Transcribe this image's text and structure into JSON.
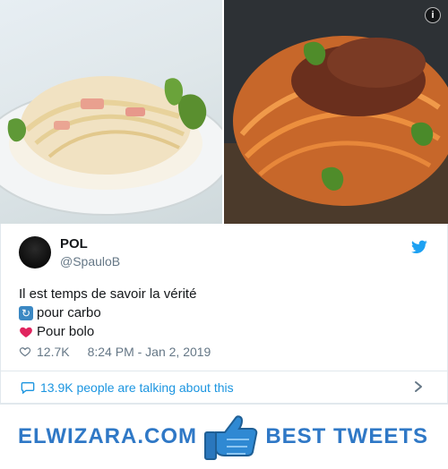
{
  "media": {
    "left_alt": "carbonara",
    "right_alt": "bolognese"
  },
  "tweet": {
    "name": "POL",
    "handle": "@SpauloB",
    "lines": [
      "Il est temps de savoir la vérité",
      "pour carbo",
      "Pour bolo"
    ],
    "likes": "12.7K",
    "timestamp": "8:24 PM - Jan 2, 2019",
    "conversation": "13.9K people are talking about this"
  },
  "footer": {
    "left_brand": "ELWIZARA.COM",
    "right_brand": "BEST TWEETS"
  },
  "colors": {
    "twitter_blue": "#1da1f2",
    "link_blue": "#1b95e0",
    "brand_blue": "#2f78c6"
  }
}
